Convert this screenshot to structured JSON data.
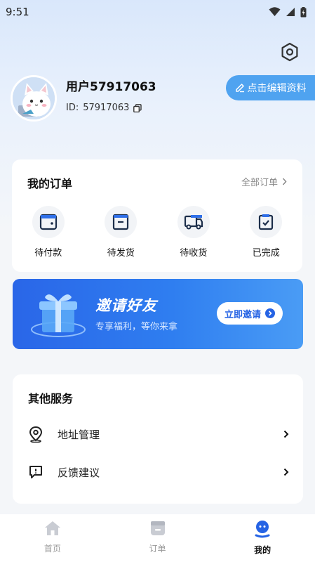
{
  "status_bar": {
    "time": "9:51"
  },
  "profile": {
    "username": "用户57917063",
    "id_label": "ID:",
    "id_value": "57917063",
    "edit_label": "点击编辑资料"
  },
  "orders": {
    "title": "我的订单",
    "all_label": "全部订单",
    "items": [
      {
        "label": "待付款",
        "icon": "wallet-icon"
      },
      {
        "label": "待发货",
        "icon": "box-icon"
      },
      {
        "label": "待收货",
        "icon": "truck-icon"
      },
      {
        "label": "已完成",
        "icon": "check-box-icon"
      }
    ]
  },
  "invite": {
    "title": "邀请好友",
    "subtitle": "专享福利，等你来拿",
    "button_label": "立即邀请"
  },
  "services": {
    "title": "其他服务",
    "items": [
      {
        "label": "地址管理",
        "icon": "location-pin-icon"
      },
      {
        "label": "反馈建议",
        "icon": "feedback-icon"
      }
    ]
  },
  "tabbar": {
    "tabs": [
      {
        "label": "首页",
        "icon": "home-icon",
        "active": false
      },
      {
        "label": "订单",
        "icon": "orders-icon",
        "active": false
      },
      {
        "label": "我的",
        "icon": "profile-icon",
        "active": true
      }
    ]
  },
  "colors": {
    "accent": "#2f7ef0",
    "edit_button": "#4fa3f0",
    "text_primary": "#111111",
    "text_secondary": "#888888"
  }
}
